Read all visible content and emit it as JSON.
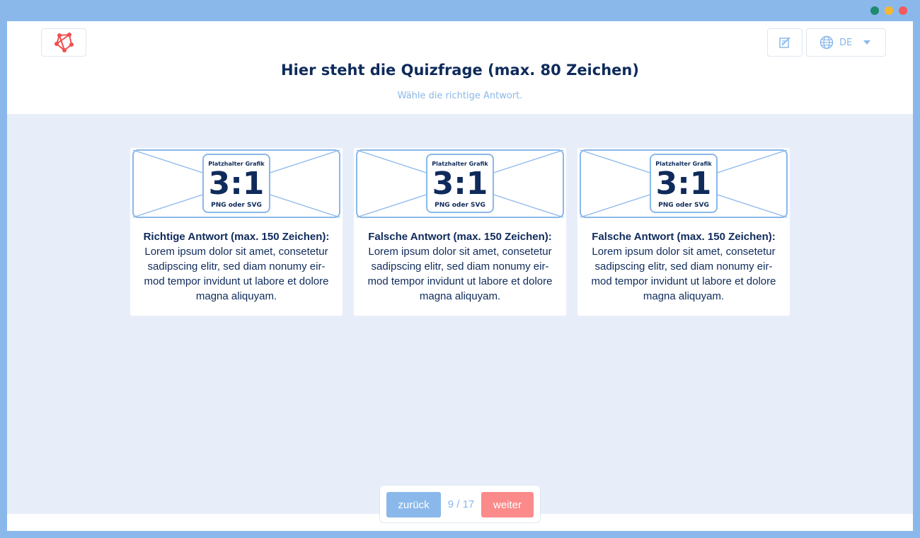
{
  "colors": {
    "frame": "#8ab8ea",
    "background": "#e8eef9",
    "navy": "#0f2b5b",
    "accent_blue": "#8ab8ea",
    "accent_red": "#fb8a8a",
    "logo_red": "#f05050",
    "dot_green": "#1e8a6e",
    "dot_yellow": "#f5b82e",
    "dot_red": "#f25b5b"
  },
  "icons": {
    "logo": "network-logo-icon",
    "edit": "edit-note-icon",
    "language": "globe-icon",
    "dropdown": "caret-down-icon"
  },
  "header": {
    "language": "DE",
    "title": "Hier steht die Quizfrage (max. 80 Zeichen)",
    "subtitle": "Wähle die richtige Antwort."
  },
  "answers": [
    {
      "placeholder": {
        "label": "Platzhalter Grafik",
        "ratio": "3:1",
        "format": "PNG oder SVG"
      },
      "heading": "Richtige Antwort (max. 150 Zeichen):",
      "body": "Lorem ipsum dolor sit amet, consetetur sadipscing elitr, sed diam nonumy eir­mod tempor invidunt ut labore et dolo­re magna aliquyam."
    },
    {
      "placeholder": {
        "label": "Platzhalter Grafik",
        "ratio": "3:1",
        "format": "PNG oder SVG"
      },
      "heading": "Falsche Antwort (max. 150 Zeichen):",
      "body": "Lorem ipsum dolor sit amet, consetetur sadipscing elitr, sed diam nonumy eir­mod tempor invidunt ut labore et dolo­re magna aliquyam."
    },
    {
      "placeholder": {
        "label": "Platzhalter Grafik",
        "ratio": "3:1",
        "format": "PNG oder SVG"
      },
      "heading": "Falsche Antwort (max. 150 Zeichen):",
      "body": "Lorem ipsum dolor sit amet, consetetur sadipscing elitr, sed diam nonumy eir­mod tempor invidunt ut labore et dolo­re magna aliquyam."
    }
  ],
  "pager": {
    "back_label": "zurück",
    "page_info": "9 / 17",
    "next_label": "weiter"
  }
}
